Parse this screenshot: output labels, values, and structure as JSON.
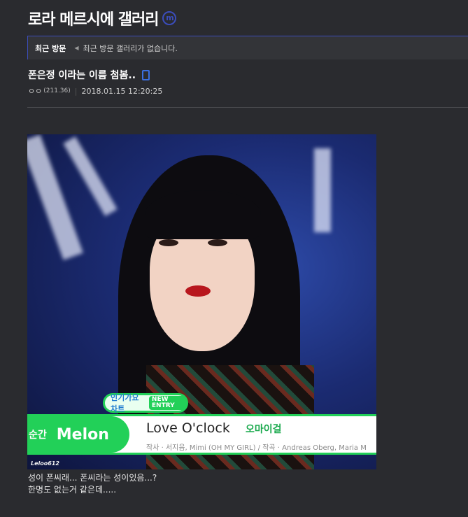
{
  "gallery": {
    "title": "로라 메르시에 갤러리",
    "badge": "m"
  },
  "recent": {
    "label": "최근 방문",
    "empty_text": "최근 방문 갤러리가 없습니다."
  },
  "post": {
    "title": "폰은정 이라는 이름 첨봄..",
    "author": "ㅇㅇ",
    "ip": "(211.36)",
    "datetime": "2018.01.15 12:20:25",
    "body_lines": [
      "성이 폰씨래... 폰씨라는 성이있음...?",
      "한명도 없는거 같은데....."
    ]
  },
  "image": {
    "badge_inkigayo": "인기가요 차트",
    "badge_new_entry": "NEW ENTRY",
    "rank_label": "순간",
    "brand": "Melon",
    "song_title": "Love O'clock",
    "artist": "오마이걸",
    "credits": "작사 · 서지음, Mimi (OH MY GIRL) / 작곡 · Andreas Oberg, Maria M",
    "uploader": "Leloo612"
  },
  "colors": {
    "background": "#2a2b2f",
    "accent": "#3b4dbb",
    "melon_green": "#22d058"
  }
}
